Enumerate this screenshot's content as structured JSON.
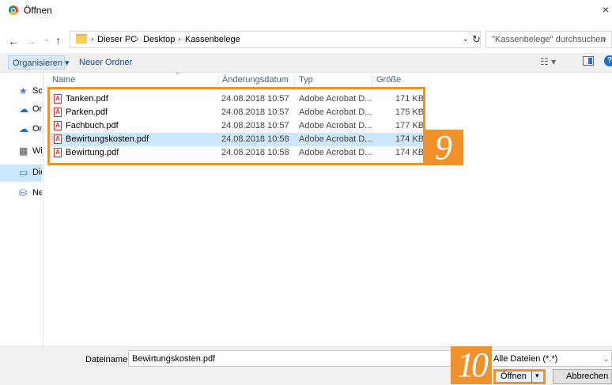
{
  "window": {
    "title": "Öffnen",
    "close": "×"
  },
  "nav": {
    "back": "←",
    "forward": "→",
    "recent": "⌄",
    "up": "↑"
  },
  "address": {
    "crumbs": [
      "Dieser PC",
      "Desktop",
      "Kassenbelege"
    ],
    "separator": "›",
    "dropdown": "⌄",
    "refresh": "↻"
  },
  "search": {
    "placeholder": "\"Kassenbelege\" durchsuchen",
    "icon": "⌕"
  },
  "toolbar": {
    "organize_label": "Organisieren ▾",
    "new_folder_label": "Neuer Ordner",
    "view_label": "☷ ▾",
    "help": "?"
  },
  "sidebar": {
    "items": [
      {
        "label": "Schnellzugriff",
        "icon": "★",
        "color": "#3a7bd5"
      },
      {
        "label": "OneDrive",
        "icon": "☁",
        "color": "#1f6fc5"
      },
      {
        "label": "OneDrive",
        "icon": "☁",
        "color": "#1f6fc5"
      },
      {
        "label": "Windows",
        "icon": "▦",
        "color": "#4a4a4a"
      },
      {
        "label": "Dieser PC",
        "icon": "▭",
        "color": "#2f7ed8"
      },
      {
        "label": "Netzwerk",
        "icon": "⛁",
        "color": "#2f7ed8"
      }
    ]
  },
  "columns": {
    "name": "Name",
    "date": "Änderungsdatum",
    "type": "Typ",
    "size": "Größe",
    "sort_indicator": "⌄"
  },
  "files": [
    {
      "name": "Tanken.pdf",
      "date": "24.08.2018 10:57",
      "type": "Adobe Acrobat D...",
      "size": "171 KB"
    },
    {
      "name": "Parken.pdf",
      "date": "24.08.2018 10:57",
      "type": "Adobe Acrobat D...",
      "size": "175 KB"
    },
    {
      "name": "Fachbuch.pdf",
      "date": "24.08.2018 10:57",
      "type": "Adobe Acrobat D...",
      "size": "177 KB"
    },
    {
      "name": "Bewirtungskosten.pdf",
      "date": "24.08.2018 10:58",
      "type": "Adobe Acrobat D...",
      "size": "174 KB"
    },
    {
      "name": "Bewirtung.pdf",
      "date": "24.08.2018 10:58",
      "type": "Adobe Acrobat D...",
      "size": "174 KB"
    }
  ],
  "selected_index": 3,
  "pdf_icon_glyph": "A",
  "footer": {
    "filename_label": "Dateiname:",
    "filename_value": "Bewirtungskosten.pdf",
    "filter": "Alle Dateien (*.*)",
    "filter_chevron": "⌄",
    "open_label": "Öffnen",
    "open_dropdown": "▾",
    "cancel_label": "Abbrechen"
  },
  "annotations": {
    "step_9": "9",
    "step_10": "10",
    "accent": "#f0912c"
  }
}
